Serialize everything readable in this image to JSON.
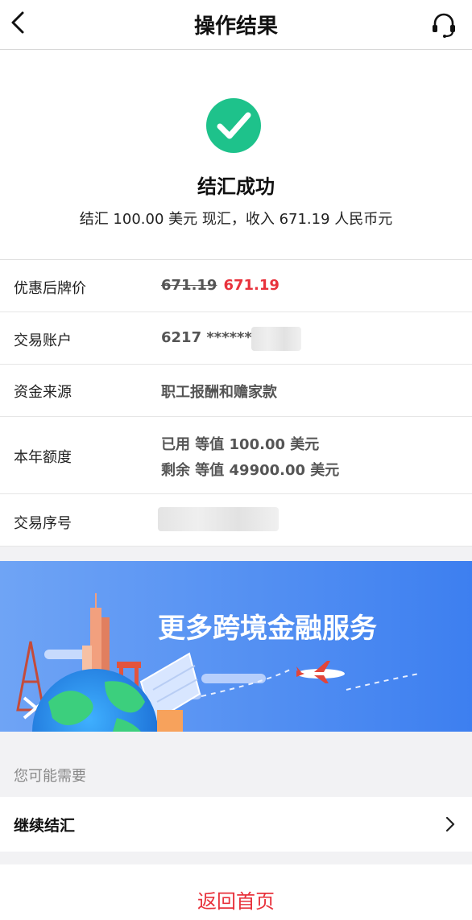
{
  "header": {
    "title": "操作结果",
    "back_icon": "chevron-left-icon",
    "service_icon": "headset-icon"
  },
  "result": {
    "status": "结汇成功",
    "summary": "结汇 100.00 美元 现汇，收入 671.19 人民币元",
    "accent": "#1ec28b"
  },
  "details": {
    "rows": [
      {
        "label": "优惠后牌价",
        "original_price": "671.19",
        "discounted_price": "671.19"
      },
      {
        "label": "交易账户",
        "value": "6217 ******"
      },
      {
        "label": "资金来源",
        "value": "职工报酬和赡家款"
      },
      {
        "label": "本年额度",
        "used": "已用 等值 100.00 美元",
        "remaining": "剩余 等值 49900.00 美元"
      },
      {
        "label": "交易序号",
        "value": ""
      }
    ]
  },
  "banner": {
    "title": "更多跨境金融服务"
  },
  "suggestions": {
    "label": "您可能需要",
    "items": [
      {
        "label": "继续结汇"
      }
    ]
  },
  "footer": {
    "home_label": "返回首页",
    "accent": "#e8323c"
  }
}
